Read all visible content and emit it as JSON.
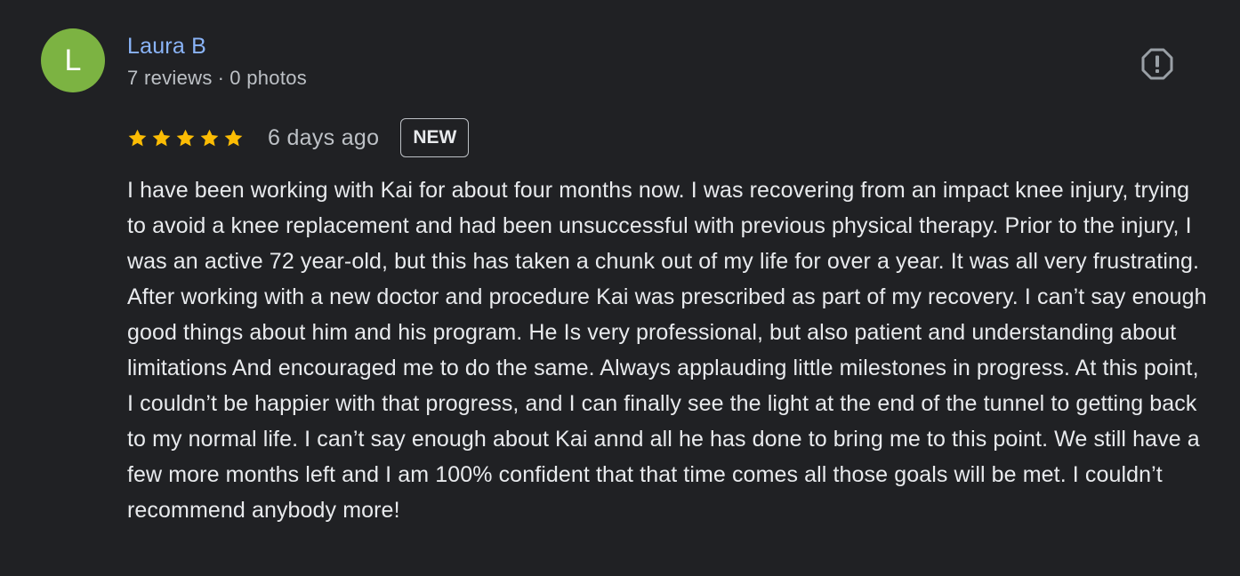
{
  "reviewer": {
    "avatar_letter": "L",
    "avatar_color": "#7cb342",
    "name": "Laura B",
    "reviews_count": "7 reviews",
    "separator": "·",
    "photos_count": "0 photos"
  },
  "report": {
    "icon": "report-flag-icon"
  },
  "review": {
    "rating": 5,
    "max_rating": 5,
    "star_color": "#fbbc04",
    "date": "6 days ago",
    "badge": "NEW",
    "text": "I have been working with Kai for about four months now. I was recovering from an impact knee injury, trying to avoid a knee replacement and had been unsuccessful with previous physical therapy. Prior to the injury, I was an active 72 year-old, but this has taken a chunk out of my life for over a year. It was all very frustrating. After working with a new doctor and procedure Kai was prescribed as part of my recovery. I can’t say enough good things about him and his program. He Is very professional, but also patient and understanding about limitations And encouraged me to do the same. Always applauding little milestones in progress. At this point, I couldn’t be happier with that progress, and I can finally see the light at the end of the tunnel to getting back to my normal life. I can’t say enough about Kai annd all he has done to bring me to this point. We still have a few more months left and I am 100% confident that that time comes all those goals will be met. I couldn’t recommend anybody more!"
  }
}
